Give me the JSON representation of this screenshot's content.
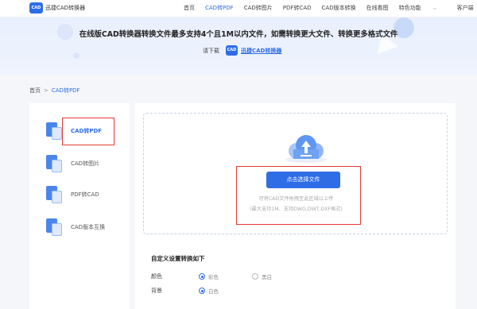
{
  "header": {
    "logo_text": "CAD",
    "brand": "迅捷CAD转换器",
    "nav": [
      {
        "label": "首页",
        "active": false
      },
      {
        "label": "CAD转PDF",
        "active": true
      },
      {
        "label": "CAD转图片",
        "active": false
      },
      {
        "label": "PDF转CAD",
        "active": false
      },
      {
        "label": "CAD版本转换",
        "active": false
      },
      {
        "label": "在线看图",
        "active": false
      },
      {
        "label": "特色功能",
        "active": false
      },
      {
        "label": "客户端",
        "active": false
      }
    ]
  },
  "banner": {
    "title": "在线版CAD转换器转换文件最多支持4个且1M以内文件，如需转换更大文件、转换更多格式文件",
    "download_prefix": "请下载",
    "logo_text": "CAD",
    "download_link": "迅捷CAD转换器"
  },
  "breadcrumb": {
    "home": "首页",
    "separator": ">",
    "current": "CAD转PDF"
  },
  "sidebar": {
    "items": [
      {
        "label": "CAD转PDF",
        "active": true
      },
      {
        "label": "CAD转图片",
        "active": false
      },
      {
        "label": "PDF转CAD",
        "active": false
      },
      {
        "label": "CAD版本互换",
        "active": false
      }
    ]
  },
  "upload": {
    "button_label": "点击选择文件",
    "hint_line1": "可将CAD文件拖拽至此区域以上传",
    "hint_line2": "(最大支持1M、支持DWG,DWT,DXF格式)"
  },
  "settings": {
    "title": "自定义设置转换如下",
    "rows": [
      {
        "name": "颜色",
        "options": [
          {
            "label": "彩色",
            "selected": true
          },
          {
            "label": "黑白",
            "selected": false
          }
        ]
      },
      {
        "name": "背景",
        "options": [
          {
            "label": "白色",
            "selected": true
          }
        ]
      }
    ]
  },
  "colors": {
    "accent": "#2f6de6",
    "highlight_box": "#e53935"
  }
}
